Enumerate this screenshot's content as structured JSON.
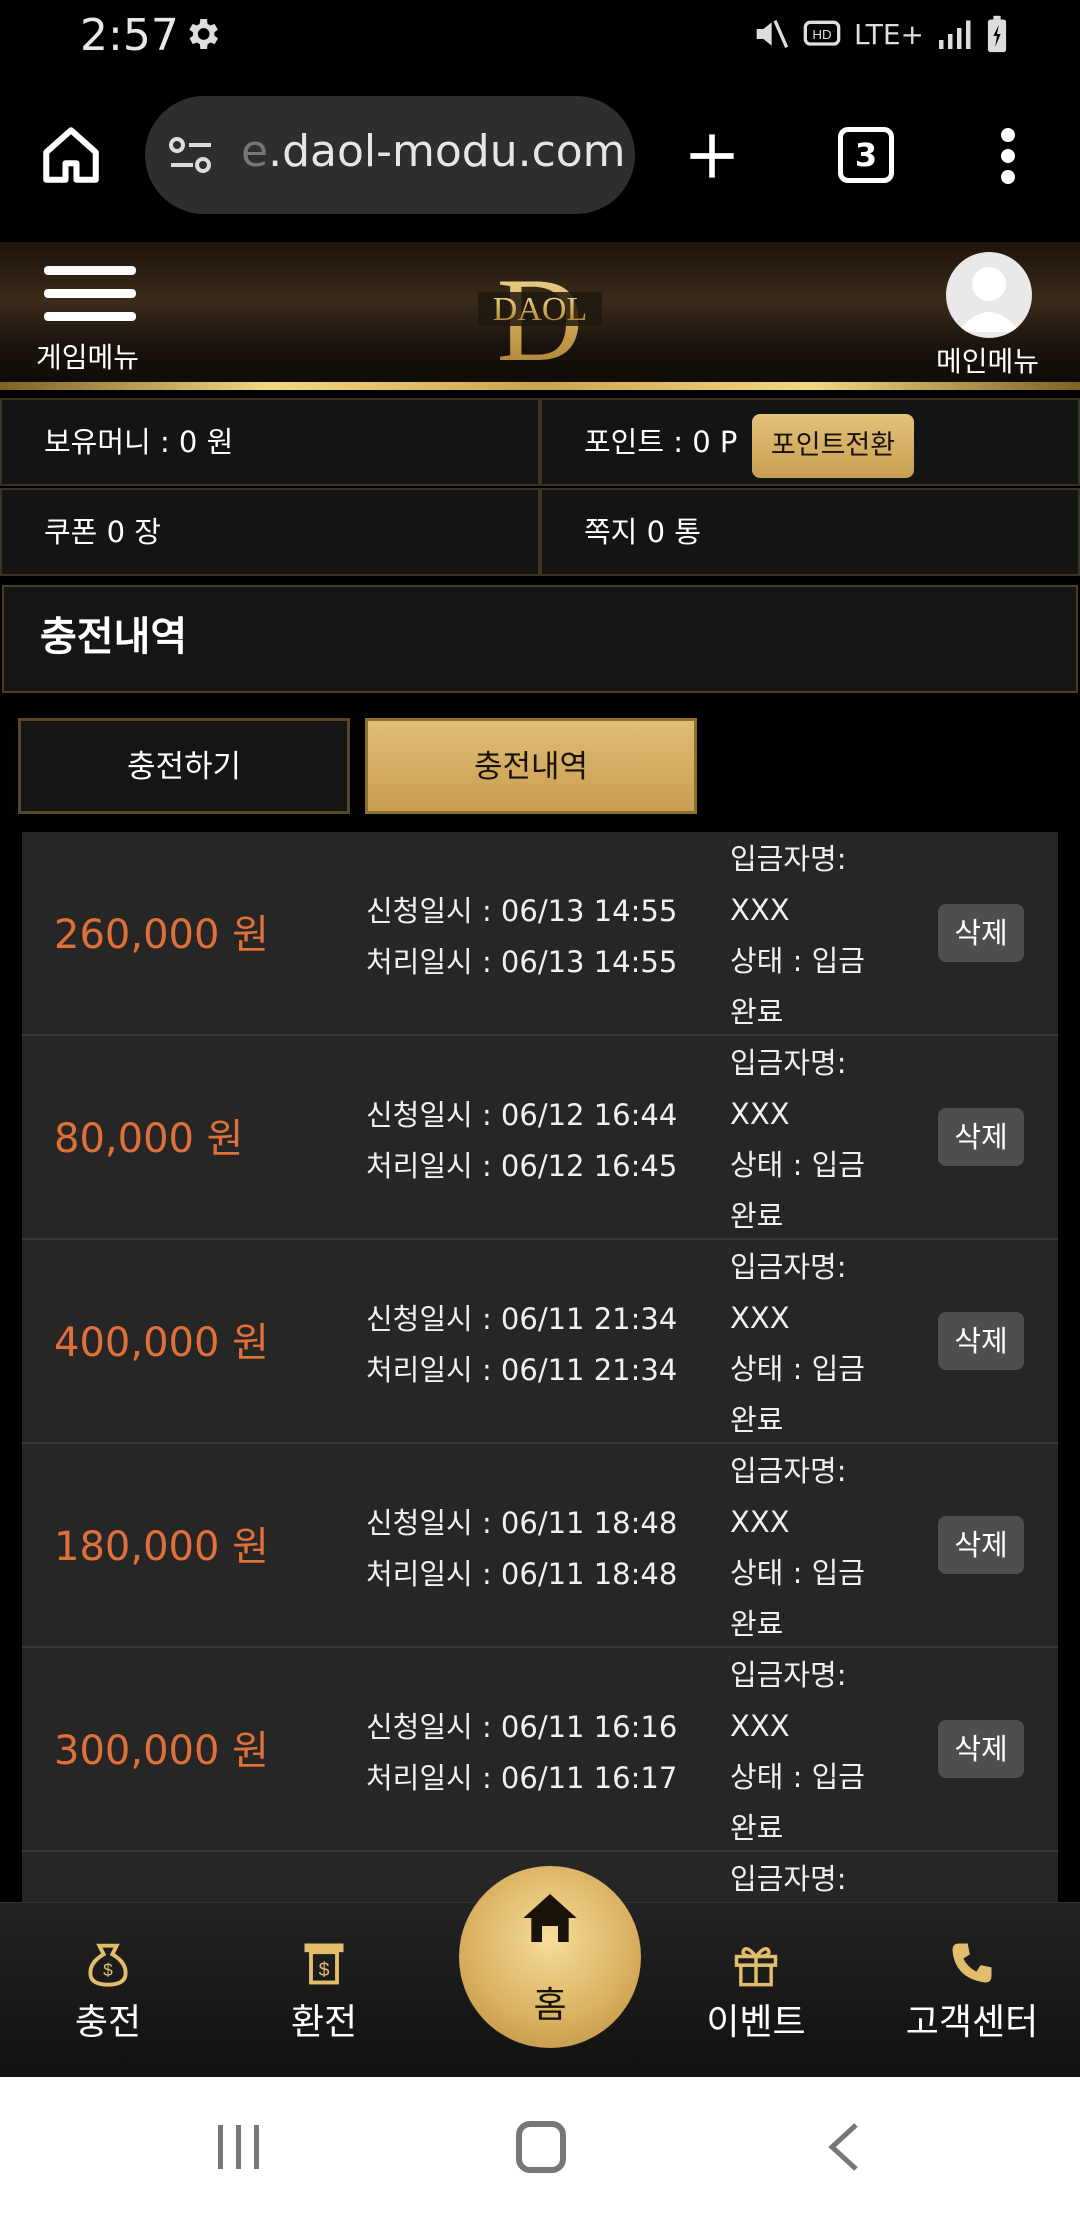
{
  "status_bar": {
    "time": "2:57",
    "network": "LTE+"
  },
  "browser": {
    "url_faded": "e",
    "url": ".daol-modu.com",
    "tab_count": "3"
  },
  "header": {
    "game_menu_label": "게임메뉴",
    "main_menu_label": "메인메뉴",
    "logo_text": "DAOL",
    "logo_letter": "D"
  },
  "info": {
    "money": "보유머니 : 0 원",
    "points": "포인트 : 0 P",
    "point_convert_button": "포인트전환",
    "coupon": "쿠폰 0 장",
    "messages": "쪽지 0 통"
  },
  "section_title": "충전내역",
  "tabs": {
    "charge": "충전하기",
    "history": "충전내역"
  },
  "history": [
    {
      "amount": "260,000 원",
      "requested": "신청일시 : 06/13 14:55",
      "processed": "처리일시 : 06/13 14:55",
      "depositor_label": "입금자명:",
      "depositor": "XXX",
      "status_line1": "상태 : 입금",
      "status_line2": "완료",
      "delete": "삭제"
    },
    {
      "amount": "80,000 원",
      "requested": "신청일시 : 06/12 16:44",
      "processed": "처리일시 : 06/12 16:45",
      "depositor_label": "입금자명:",
      "depositor": "XXX",
      "status_line1": "상태 : 입금",
      "status_line2": "완료",
      "delete": "삭제"
    },
    {
      "amount": "400,000 원",
      "requested": "신청일시 : 06/11 21:34",
      "processed": "처리일시 : 06/11 21:34",
      "depositor_label": "입금자명:",
      "depositor": "XXX",
      "status_line1": "상태 : 입금",
      "status_line2": "완료",
      "delete": "삭제"
    },
    {
      "amount": "180,000 원",
      "requested": "신청일시 : 06/11 18:48",
      "processed": "처리일시 : 06/11 18:48",
      "depositor_label": "입금자명:",
      "depositor": "XXX",
      "status_line1": "상태 : 입금",
      "status_line2": "완료",
      "delete": "삭제"
    },
    {
      "amount": "300,000 원",
      "requested": "신청일시 : 06/11 16:16",
      "processed": "처리일시 : 06/11 16:17",
      "depositor_label": "입금자명:",
      "depositor": "XXX",
      "status_line1": "상태 : 입금",
      "status_line2": "완료",
      "delete": "삭제"
    },
    {
      "depositor_label": "입금자명:"
    }
  ],
  "bottom_nav": {
    "charge": "충전",
    "exchange": "환전",
    "home": "홈",
    "event": "이벤트",
    "support": "고객센터"
  },
  "colors": {
    "gold": "#d7af5e",
    "amount": "#e0703a",
    "row_bg": "#262626"
  }
}
